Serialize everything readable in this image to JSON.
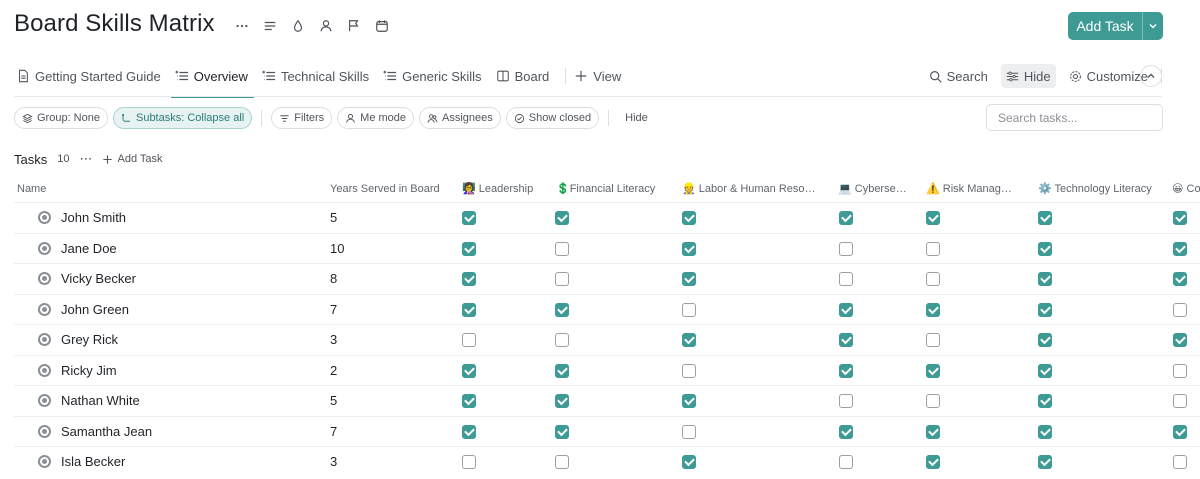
{
  "page_title": "Board Skills Matrix",
  "add_task_label": "Add Task",
  "tabs": [
    {
      "label": "Getting Started Guide",
      "active": false
    },
    {
      "label": "Overview",
      "active": true
    },
    {
      "label": "Technical Skills",
      "active": false
    },
    {
      "label": "Generic Skills",
      "active": false
    },
    {
      "label": "Board",
      "active": false
    },
    {
      "label": "View",
      "active": false
    }
  ],
  "right_tools": {
    "search": "Search",
    "hide": "Hide",
    "customize": "Customize"
  },
  "filters": {
    "group": "Group: None",
    "subtasks": "Subtasks: Collapse all",
    "filters": "Filters",
    "me_mode": "Me mode",
    "assignees": "Assignees",
    "show_closed": "Show closed",
    "hide": "Hide"
  },
  "search_placeholder": "Search tasks...",
  "tasks_header": {
    "label": "Tasks",
    "count": "10",
    "add_task": "Add Task"
  },
  "columns": [
    "Name",
    "Years Served in Board",
    "👩‍🏫 Leadership",
    "💲Financial Literacy",
    "👷 Labor & Human Resources",
    "💻 Cybersecurity",
    "⚠️ Risk Management",
    "⚙️ Technology Literacy",
    "😀 Co"
  ],
  "rows": [
    {
      "name": "John Smith",
      "years": "5",
      "skills": [
        true,
        true,
        true,
        true,
        true,
        true,
        true
      ]
    },
    {
      "name": "Jane Doe",
      "years": "10",
      "skills": [
        true,
        false,
        true,
        false,
        false,
        true,
        true
      ]
    },
    {
      "name": "Vicky Becker",
      "years": "8",
      "skills": [
        true,
        false,
        true,
        false,
        false,
        true,
        true
      ]
    },
    {
      "name": "John Green",
      "years": "7",
      "skills": [
        true,
        true,
        false,
        true,
        true,
        true,
        false
      ]
    },
    {
      "name": "Grey Rick",
      "years": "3",
      "skills": [
        false,
        false,
        true,
        true,
        false,
        true,
        true
      ]
    },
    {
      "name": "Ricky Jim",
      "years": "2",
      "skills": [
        true,
        true,
        false,
        true,
        true,
        true,
        false
      ]
    },
    {
      "name": "Nathan White",
      "years": "5",
      "skills": [
        true,
        true,
        true,
        false,
        false,
        true,
        false
      ]
    },
    {
      "name": "Samantha Jean",
      "years": "7",
      "skills": [
        true,
        true,
        false,
        true,
        true,
        true,
        true
      ]
    },
    {
      "name": "Isla Becker",
      "years": "3",
      "skills": [
        false,
        false,
        true,
        false,
        true,
        true,
        false
      ]
    }
  ],
  "colors": {
    "accent": "#3d9a94"
  }
}
